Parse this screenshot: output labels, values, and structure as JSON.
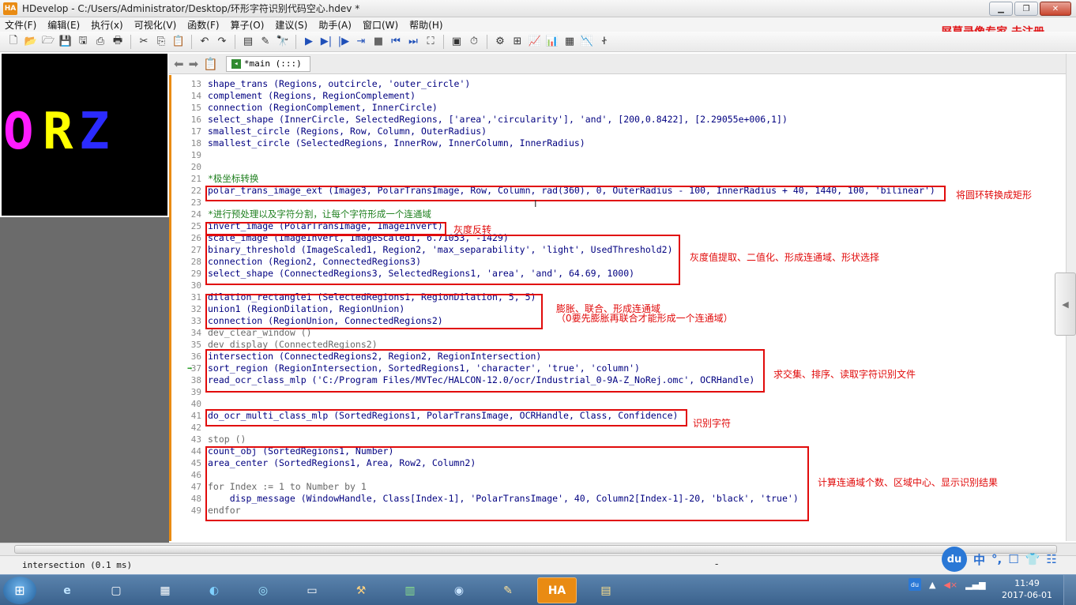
{
  "window": {
    "title": "HDevelop - C:/Users/Administrator/Desktop/环形字符识别代码空心.hdev *",
    "logo": "HA"
  },
  "menu": [
    "文件(F)",
    "编辑(E)",
    "执行(x)",
    "可视化(V)",
    "函数(F)",
    "算子(O)",
    "建议(S)",
    "助手(A)",
    "窗口(W)",
    "帮助(H)"
  ],
  "watermark": "屏幕录像专家 未注册",
  "graphics": {
    "letters": [
      "O",
      "R",
      "Z"
    ],
    "colors": [
      "#ff1cff",
      "#ffff00",
      "#2b2bff"
    ]
  },
  "editor": {
    "tab_label": "*main (:::)",
    "lines": [
      {
        "n": "13",
        "code": "shape_trans (Regions, outcircle, 'outer_circle')"
      },
      {
        "n": "14",
        "code": "complement (Regions, RegionComplement)"
      },
      {
        "n": "15",
        "code": "connection (RegionComplement, InnerCircle)"
      },
      {
        "n": "16",
        "code": "select_shape (InnerCircle, SelectedRegions, ['area','circularity'], 'and', [200,0.8422], [2.29055e+006,1])"
      },
      {
        "n": "17",
        "code": "smallest_circle (Regions, Row, Column, OuterRadius)"
      },
      {
        "n": "18",
        "code": "smallest_circle (SelectedRegions, InnerRow, InnerColumn, InnerRadius)"
      },
      {
        "n": "19",
        "code": ""
      },
      {
        "n": "20",
        "code": ""
      },
      {
        "n": "21",
        "code": "*极坐标转换"
      },
      {
        "n": "22",
        "code": "polar_trans_image_ext (Image3, PolarTransImage, Row, Column, rad(360), 0, OuterRadius - 100, InnerRadius + 40, 1440, 100, 'bilinear')"
      },
      {
        "n": "23",
        "code": ""
      },
      {
        "n": "24",
        "code": "*进行预处理以及字符分割，让每个字符形成一个连通域"
      },
      {
        "n": "25",
        "code": "invert_image (PolarTransImage, ImageInvert)"
      },
      {
        "n": "26",
        "code": "scale_image (ImageInvert, ImageScaled1, 6.71053, -1429)"
      },
      {
        "n": "27",
        "code": "binary_threshold (ImageScaled1, Region2, 'max_separability', 'light', UsedThreshold2)"
      },
      {
        "n": "28",
        "code": "connection (Region2, ConnectedRegions3)"
      },
      {
        "n": "29",
        "code": "select_shape (ConnectedRegions3, SelectedRegions1, 'area', 'and', 64.69, 1000)"
      },
      {
        "n": "30",
        "code": ""
      },
      {
        "n": "31",
        "code": "dilation_rectangle1 (SelectedRegions1, RegionDilation, 5, 5)"
      },
      {
        "n": "32",
        "code": "union1 (RegionDilation, RegionUnion)"
      },
      {
        "n": "33",
        "code": "connection (RegionUnion, ConnectedRegions2)"
      },
      {
        "n": "34",
        "code": "dev_clear_window ()"
      },
      {
        "n": "35",
        "code": "dev_display (ConnectedRegions2)"
      },
      {
        "n": "36",
        "code": "intersection (ConnectedRegions2, Region2, RegionIntersection)"
      },
      {
        "n": "37",
        "code": "sort_region (RegionIntersection, SortedRegions1, 'character', 'true', 'column')"
      },
      {
        "n": "38",
        "code": "read_ocr_class_mlp ('C:/Program Files/MVTec/HALCON-12.0/ocr/Industrial_0-9A-Z_NoRej.omc', OCRHandle)"
      },
      {
        "n": "39",
        "code": ""
      },
      {
        "n": "40",
        "code": ""
      },
      {
        "n": "41",
        "code": "do_ocr_multi_class_mlp (SortedRegions1, PolarTransImage, OCRHandle, Class, Confidence)"
      },
      {
        "n": "42",
        "code": ""
      },
      {
        "n": "43",
        "code": "stop ()"
      },
      {
        "n": "44",
        "code": "count_obj (SortedRegions1, Number)"
      },
      {
        "n": "45",
        "code": "area_center (SortedRegions1, Area, Row2, Column2)"
      },
      {
        "n": "46",
        "code": ""
      },
      {
        "n": "47",
        "code": "for Index := 1 to Number by 1"
      },
      {
        "n": "48",
        "code": "    disp_message (WindowHandle, Class[Index-1], 'PolarTransImage', 40, Column2[Index-1]-20, 'black', 'true')"
      },
      {
        "n": "49",
        "code": "endfor"
      }
    ]
  },
  "annotations": [
    "将圆环转换成矩形",
    "灰度反转",
    "灰度值提取、二值化、形成连通域、形状选择",
    "膨胀、联合、形成连通域",
    "（0要先膨胀再联合才能形成一个连通域）",
    "求交集、排序、读取字符识别文件",
    "识别字符",
    "计算连通域个数、区域中心、显示识别结果"
  ],
  "status": {
    "text": "intersection (0.1 ms)",
    "right": "-"
  },
  "ime": {
    "logo": "du",
    "lang": "中",
    "punct": "°,",
    "icons": [
      "☐",
      "👕",
      "☷"
    ]
  },
  "taskbar": {
    "apps": [
      "e",
      "▢",
      "▦",
      "◐",
      "◎",
      "▭",
      "⚒",
      "▥",
      "◉",
      "✎",
      "HA",
      "▤"
    ],
    "tray_du": "du",
    "tray_arrow": "▲",
    "tray_sound": "◀×",
    "tray_signal": "▂▄▆",
    "time": "11:49",
    "date": "2017-06-01"
  }
}
